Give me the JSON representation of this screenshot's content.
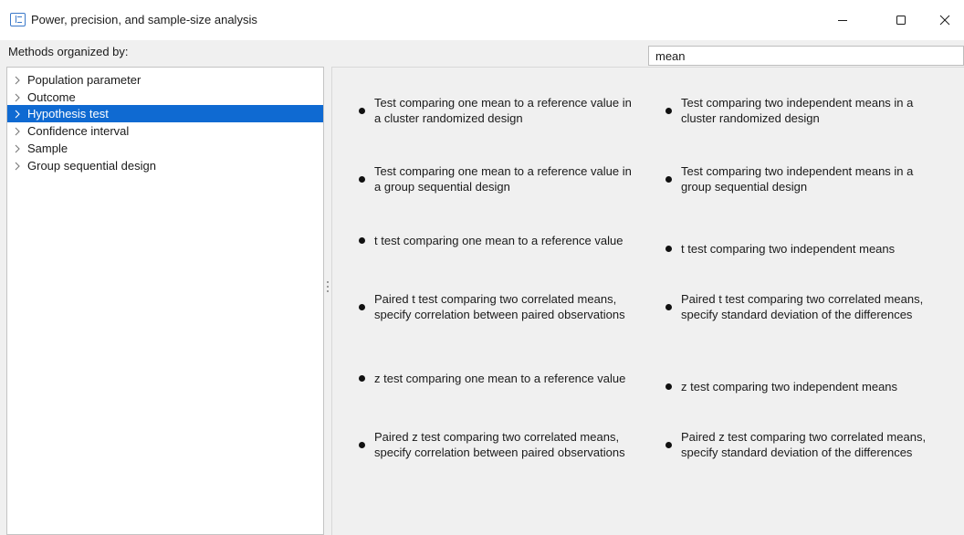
{
  "window": {
    "title": "Power, precision, and sample-size analysis"
  },
  "header": {
    "methods_label": "Methods organized by:",
    "search_value": "mean",
    "search_placeholder": ""
  },
  "tree": {
    "items": [
      {
        "label": "Population parameter",
        "selected": false
      },
      {
        "label": "Outcome",
        "selected": false
      },
      {
        "label": "Hypothesis test",
        "selected": true
      },
      {
        "label": "Confidence interval",
        "selected": false
      },
      {
        "label": "Sample",
        "selected": false
      },
      {
        "label": "Group sequential design",
        "selected": false
      }
    ]
  },
  "methods": {
    "left": [
      "Test comparing one mean to a reference value in a cluster randomized design",
      "Test comparing one mean to a reference value in a group sequential design",
      "t test comparing one mean to a reference value",
      "Paired t test comparing two correlated means, specify correlation between paired observations",
      "z test comparing one mean to a reference value",
      "Paired z test comparing two correlated means, specify correlation between paired observations"
    ],
    "right": [
      "Test comparing two independent means in a cluster randomized design",
      "Test comparing two independent means in a group sequential design",
      "t test comparing two independent means",
      "Paired t test comparing two correlated means, specify standard deviation of the differences",
      "z test comparing two independent means",
      "Paired z test comparing two correlated means, specify standard deviation of the differences"
    ]
  },
  "colors": {
    "selection": "#0f6ad2",
    "app_icon": "#3a78c9"
  },
  "icons": {
    "app": "table-icon",
    "minimize": "minimize-icon",
    "maximize": "maximize-icon",
    "close": "close-icon",
    "tree_expand": "chevron-right-icon",
    "bullet": "bullet-icon"
  }
}
